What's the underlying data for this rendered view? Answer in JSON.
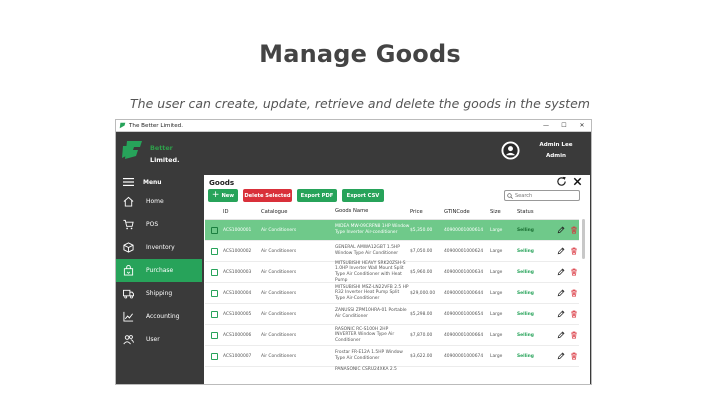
{
  "slide": {
    "title": "Manage Goods",
    "subtitle": "The user can create, update, retrieve and delete the goods in the system"
  },
  "window": {
    "title": "The Better Limited.",
    "controls": [
      "—",
      "☐",
      "✕"
    ]
  },
  "header": {
    "company_line1": "Better",
    "company_line2": "Limited.",
    "user_name": "Admin Lee",
    "user_role": "Admin"
  },
  "sidebar": {
    "menu_label": "Menu",
    "items": [
      {
        "label": "Home",
        "icon": "home-icon"
      },
      {
        "label": "POS",
        "icon": "cart-icon"
      },
      {
        "label": "Inventory",
        "icon": "box-icon"
      },
      {
        "label": "Purchase",
        "icon": "bag-icon"
      },
      {
        "label": "Shipping",
        "icon": "truck-icon"
      },
      {
        "label": "Accounting",
        "icon": "chart-icon"
      },
      {
        "label": "User",
        "icon": "users-icon"
      }
    ],
    "active": "Purchase"
  },
  "content": {
    "title": "Goods",
    "buttons": {
      "new": "New",
      "delete_selected": "Delete Selected",
      "export_pdf": "Export PDF",
      "export_csv": "Export CSV"
    },
    "search_placeholder": "Search"
  },
  "table": {
    "headers": [
      "ID",
      "Catalogue",
      "Goods Name",
      "Price",
      "GTINCode",
      "Size",
      "Status"
    ],
    "rows": [
      {
        "id": "ACS1000001",
        "catalogue": "Air Conditioners",
        "name": "MIDEA MW-09CRFN8 1HP Window Type Inverter Air-conditioner",
        "price": "$5,350.00",
        "gtin": "40900001000614",
        "size": "Large",
        "status": "Selling",
        "selected": true
      },
      {
        "id": "ACS1000002",
        "catalogue": "Air Conditioners",
        "name": "GENERAL AMWA12GBT 1.5HP Window Type Air Conditioner",
        "price": "$7,050.00",
        "gtin": "40900001000624",
        "size": "Large",
        "status": "Selling",
        "selected": false
      },
      {
        "id": "ACS1000003",
        "catalogue": "Air Conditioners",
        "name": "MITSUBISHI HEAVY SRK20ZSH-S 1.0HP Inverter Wall Mount Split Type Air Conditioner with Heat Pump",
        "price": "$5,960.00",
        "gtin": "40900001000634",
        "size": "Large",
        "status": "Selling",
        "selected": false
      },
      {
        "id": "ACS1000004",
        "catalogue": "Air Conditioners",
        "name": "MITSUBISHI MSZ-LN22VFB 2.5 HP R32 Inverter Heat Pump Split Type Air-Conditioner",
        "price": "$29,000.00",
        "gtin": "40900001000644",
        "size": "Large",
        "status": "Selling",
        "selected": false
      },
      {
        "id": "ACS1000005",
        "catalogue": "Air Conditioners",
        "name": "ZANUSSI ZPM10HRA-01 Portable Air Conditioner",
        "price": "$5,298.00",
        "gtin": "40900001000654",
        "size": "Large",
        "status": "Selling",
        "selected": false
      },
      {
        "id": "ACS1000006",
        "catalogue": "Air Conditioners",
        "name": "RASONIC RC-S100H 2HP INVERTER Window Type Air Conditioner",
        "price": "$7,870.00",
        "gtin": "40900001000664",
        "size": "Large",
        "status": "Selling",
        "selected": false
      },
      {
        "id": "ACS1000007",
        "catalogue": "Air Conditioners",
        "name": "Frostar FR-E12A 1.5HP Window Type Air Conditioner",
        "price": "$3,622.00",
        "gtin": "40900001000674",
        "size": "Large",
        "status": "Selling",
        "selected": false
      },
      {
        "id": "",
        "catalogue": "",
        "name": "PANASONIC CSRU24XKA 2.5",
        "price": "",
        "gtin": "",
        "size": "",
        "status": "",
        "selected": false
      }
    ]
  },
  "colors": {
    "accent_green": "#27a35a",
    "selected_row": "#6fc98a",
    "delete_red": "#d9303a",
    "dark_bg": "#3a3a3a"
  }
}
